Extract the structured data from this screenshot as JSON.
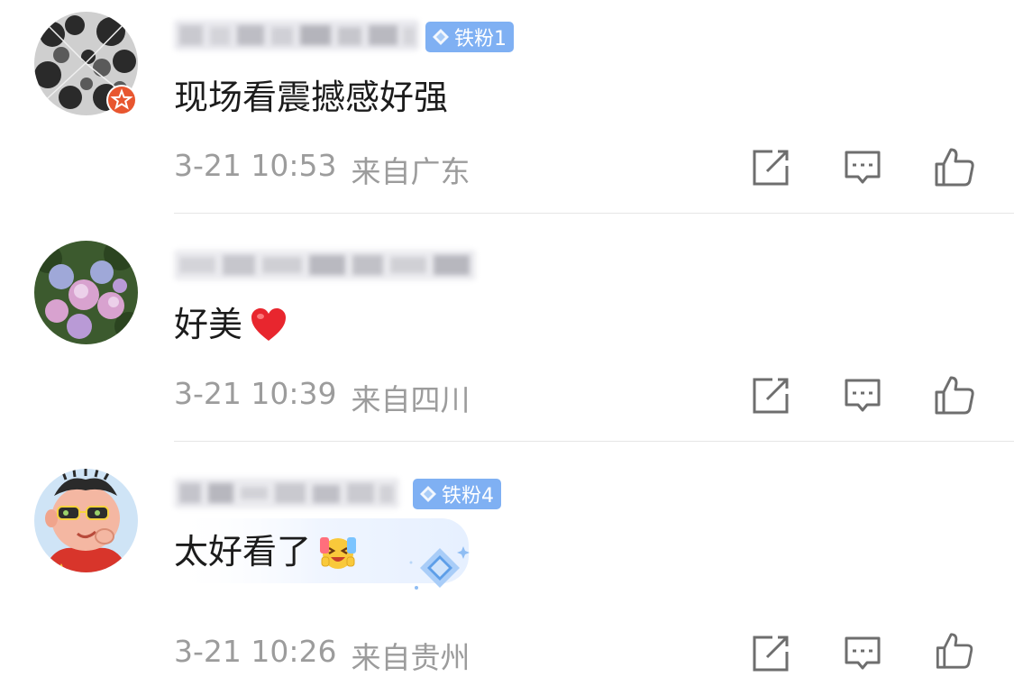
{
  "comments": [
    {
      "fan_badge": "铁粉1",
      "text": "现场看震撼感好强",
      "time": "3-21 10:53",
      "location": "来自广东",
      "avatar_icon": "forest-canopy-avatar",
      "has_verified_badge": true,
      "emoji_icon": null
    },
    {
      "fan_badge": null,
      "text": "好美",
      "time": "3-21 10:39",
      "location": "来自四川",
      "avatar_icon": "hydrangea-avatar",
      "has_verified_badge": false,
      "emoji_icon": "red-heart-icon"
    },
    {
      "fan_badge": "铁粉4",
      "text": "太好看了",
      "time": "3-21 10:26",
      "location": "来自贵州",
      "avatar_icon": "cartoon-boy-avatar",
      "has_verified_badge": false,
      "emoji_icon": "excited-face-icon"
    }
  ],
  "actions": [
    "repost-icon",
    "comment-icon",
    "like-icon"
  ],
  "colors": {
    "fan_badge_bg": "#7fb0f3",
    "meta_text": "#9c9c9c",
    "icon_stroke": "#6e6e6e",
    "divider": "#e6e6e6"
  }
}
